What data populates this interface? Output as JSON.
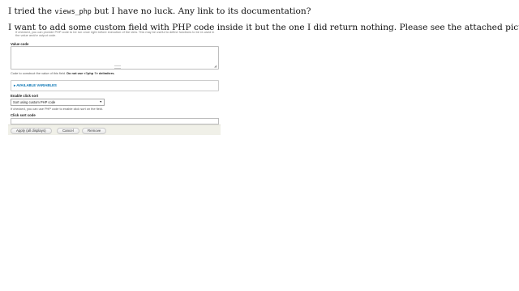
{
  "intro": {
    "line1_before": "I tried the",
    "line1_code": "views_php",
    "line1_after": "but I have no luck. Any link to its documentation?",
    "line2": "I want to add some custom field with PHP code inside it but the one I did return nothing. Please see the attached picture."
  },
  "form": {
    "cut_note": "If checked, you can provide PHP code to be run once right before execution of the view. This may be useful to define functions to be re-used in the value and/or output code.",
    "value_code_label": "Value code",
    "value_code_value": "",
    "value_code_desc_prefix": "Code to construct the value of this field.",
    "value_code_desc_bold": "Do not use <?php ?> delimiters.",
    "available_variables": "▸ AVAILABLE VARIABLES",
    "click_sort_label": "Enable click sort",
    "click_sort_selected": "Sort using custom PHP code",
    "click_sort_desc": "If checked, you can use PHP code to enable click sort on the field.",
    "click_sort_code_label": "Click sort code",
    "click_sort_code_value": "",
    "buttons": {
      "apply": "Apply (all displays)",
      "cancel": "Cancel",
      "remove": "Remove"
    }
  },
  "icons": {
    "select_arrow": "chevron-down-icon",
    "resize_handle": "resize-grip-icon"
  },
  "colors": {
    "link": "#0071b3",
    "actions_bg": "#f0f0e8"
  }
}
